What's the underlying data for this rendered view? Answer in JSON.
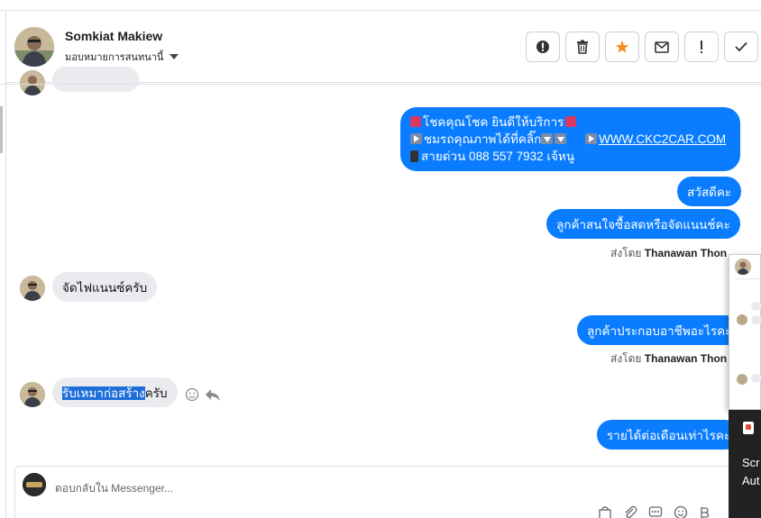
{
  "header": {
    "contact_name": "Somkiat Makiew",
    "assign_label": "มอบหมายการสนทนานี้"
  },
  "actions": [
    {
      "name": "spam-button",
      "icon": "alert-circle-icon",
      "glyph": "⬤"
    },
    {
      "name": "delete-button",
      "icon": "trash-icon",
      "glyph": "🗑"
    },
    {
      "name": "star-button",
      "icon": "star-icon",
      "glyph": "★",
      "color": "#f0901f"
    },
    {
      "name": "mark-unread-button",
      "icon": "envelope-icon",
      "glyph": "✉"
    },
    {
      "name": "follow-up-button",
      "icon": "exclamation-icon",
      "glyph": "!"
    },
    {
      "name": "mark-done-button",
      "icon": "check-icon",
      "glyph": "✓"
    }
  ],
  "messages": {
    "promo_line1": "โชคคุณโชค ยินดีให้บริการ",
    "promo_line2": "ชมรถคุณภาพได้ที่คลิ๊ก",
    "promo_link": "WWW.CKC2CAR.COM",
    "promo_line3": "สายด่วน 088 557 7932 เจ้หนู",
    "hello": "สวัสดีคะ",
    "ask_finance": "ลูกค้าสนใจซื้อสดหรือจัดแนนช์คะ",
    "sent_by_prefix": "ส่งโดย",
    "sent_by_name": "Thanawan Thon",
    "reply_finance": "จัดไฟแนนซ์ครับ",
    "ask_job": "ลูกค้าประกอบอาชีพอะไรคะ",
    "reply_job_highlight": "รับเหมาก่อสร้าง",
    "reply_job_rest": "ครับ",
    "ask_income": "รายได้ต่อเดือนเท่าไรคะ"
  },
  "compose": {
    "placeholder": "ตอบกลับใน Messenger..."
  },
  "side_panel": {
    "line1": "Scr",
    "line2": "Aut"
  },
  "colors": {
    "outgoing_bubble": "#0a7cff",
    "incoming_bubble": "#e9ebee",
    "star": "#f0901f"
  }
}
